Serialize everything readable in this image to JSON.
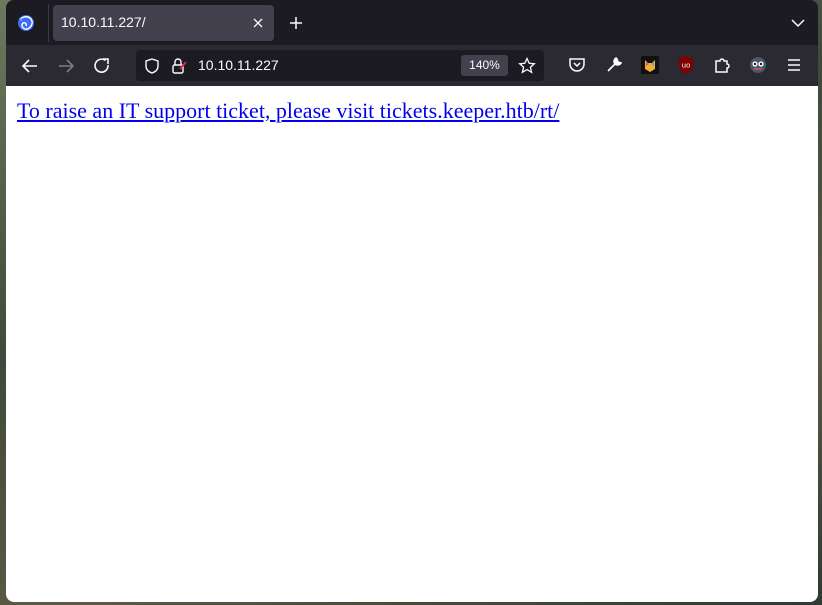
{
  "tabs": [
    {
      "title": "10.10.11.227/"
    }
  ],
  "urlbar": {
    "url": "10.10.11.227",
    "zoom": "140%"
  },
  "page": {
    "link_text": "To raise an IT support ticket, please visit tickets.keeper.htb/rt/"
  },
  "colors": {
    "chrome_dark": "#1c1b22",
    "toolbar": "#2b2a33",
    "tab_active": "#42414d",
    "link": "#0000ee"
  },
  "icons": [
    "firefox-logo-icon",
    "close-icon",
    "plus-icon",
    "chevron-down-icon",
    "back-arrow-icon",
    "forward-arrow-icon",
    "reload-icon",
    "shield-icon",
    "lock-warning-icon",
    "star-icon",
    "pocket-icon",
    "wrench-icon",
    "extension-cat-icon",
    "ublock-origin-icon",
    "puzzle-icon",
    "extension-face-icon",
    "hamburger-menu-icon"
  ]
}
